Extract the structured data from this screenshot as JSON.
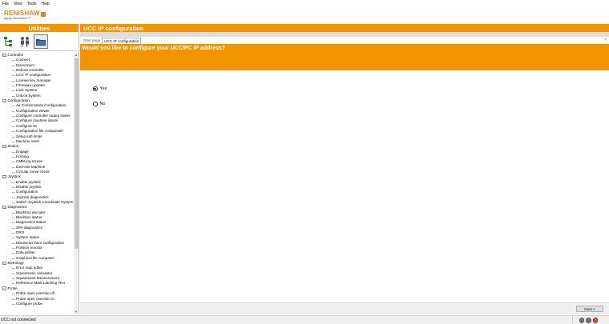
{
  "menubar": {
    "items": [
      "File",
      "View",
      "Tools",
      "Help"
    ]
  },
  "logo": {
    "word": "RENISHAW",
    "tagline": "apply innovation™"
  },
  "panel_title": "Utilities",
  "page_title": "UCC IP configuration",
  "toolbar": {
    "icons": [
      "tree-view-icon",
      "people-icon",
      "folder-icon"
    ]
  },
  "tree": [
    {
      "label": "Controller",
      "type": "group"
    },
    {
      "label": "Connect",
      "type": "child"
    },
    {
      "label": "Disconnect",
      "type": "child"
    },
    {
      "label": "Reboot controller",
      "type": "child"
    },
    {
      "label": "UCC IP configuration",
      "type": "child"
    },
    {
      "label": "License key manager",
      "type": "child"
    },
    {
      "label": "Firmware updater",
      "type": "child"
    },
    {
      "label": "Lock System",
      "type": "child"
    },
    {
      "label": "Unlock System",
      "type": "child"
    },
    {
      "label": "Configuration",
      "type": "group"
    },
    {
      "label": "Air Conservation Configuration",
      "type": "child"
    },
    {
      "label": "Configuration viewer",
      "type": "child"
    },
    {
      "label": "Configure controller output states",
      "type": "child"
    },
    {
      "label": "Configure machine inputs",
      "type": "child"
    },
    {
      "label": "Configure ID",
      "type": "child"
    },
    {
      "label": "Configuration file comparator",
      "type": "child"
    },
    {
      "label": "Setup soft limits",
      "type": "child"
    },
    {
      "label": "Machine reset",
      "type": "child"
    },
    {
      "label": "Motion",
      "type": "group"
    },
    {
      "label": "Engage",
      "type": "child"
    },
    {
      "label": "Homing",
      "type": "child"
    },
    {
      "label": "CMM jog screen",
      "type": "child"
    },
    {
      "label": "Exercise Machine",
      "type": "child"
    },
    {
      "label": "Circular move check",
      "type": "child"
    },
    {
      "label": "Joystick",
      "type": "group"
    },
    {
      "label": "Enable joystick",
      "type": "child"
    },
    {
      "label": "Disable joystick",
      "type": "child"
    },
    {
      "label": "Configuration",
      "type": "child"
    },
    {
      "label": "Joystick diagnostics",
      "type": "child"
    },
    {
      "label": "Switch Joystick Coordinate System",
      "type": "child"
    },
    {
      "label": "Diagnostics",
      "type": "group"
    },
    {
      "label": "Blackbox decoder",
      "type": "child"
    },
    {
      "label": "Blackbox status",
      "type": "child"
    },
    {
      "label": "Diagnostics status",
      "type": "child"
    },
    {
      "label": "SPA diagnostics",
      "type": "child"
    },
    {
      "label": "DRO",
      "type": "child"
    },
    {
      "label": "System status",
      "type": "child"
    },
    {
      "label": "Movescan trace configuration",
      "type": "child"
    },
    {
      "label": "Position monitor",
      "type": "child"
    },
    {
      "label": "Data plotter",
      "type": "child"
    },
    {
      "label": "Graphical file comparer",
      "type": "child"
    },
    {
      "label": "Metrology",
      "type": "group"
    },
    {
      "label": "Error map editor",
      "type": "child"
    },
    {
      "label": "Squareness calculator",
      "type": "child"
    },
    {
      "label": "Squareness Measurement",
      "type": "child"
    },
    {
      "label": "Reference Mark Latching Test",
      "type": "child"
    },
    {
      "label": "Probe",
      "type": "group"
    },
    {
      "label": "Probe open override off",
      "type": "child"
    },
    {
      "label": "Probe open override on",
      "type": "child"
    },
    {
      "label": "Configure probe",
      "type": "child"
    }
  ],
  "tabs": [
    {
      "label": "Start page",
      "active": false
    },
    {
      "label": "UCC IP configuration",
      "active": true
    }
  ],
  "tab_close": "×",
  "question": "Would you like to configure your UCC/PC IP address?",
  "options": [
    {
      "label": "Yes",
      "selected": true
    },
    {
      "label": "No",
      "selected": false
    }
  ],
  "next_button": "Next >",
  "status": "UCC not connected",
  "colors": {
    "accent": "#f29400",
    "logo": "#e97d1c"
  }
}
